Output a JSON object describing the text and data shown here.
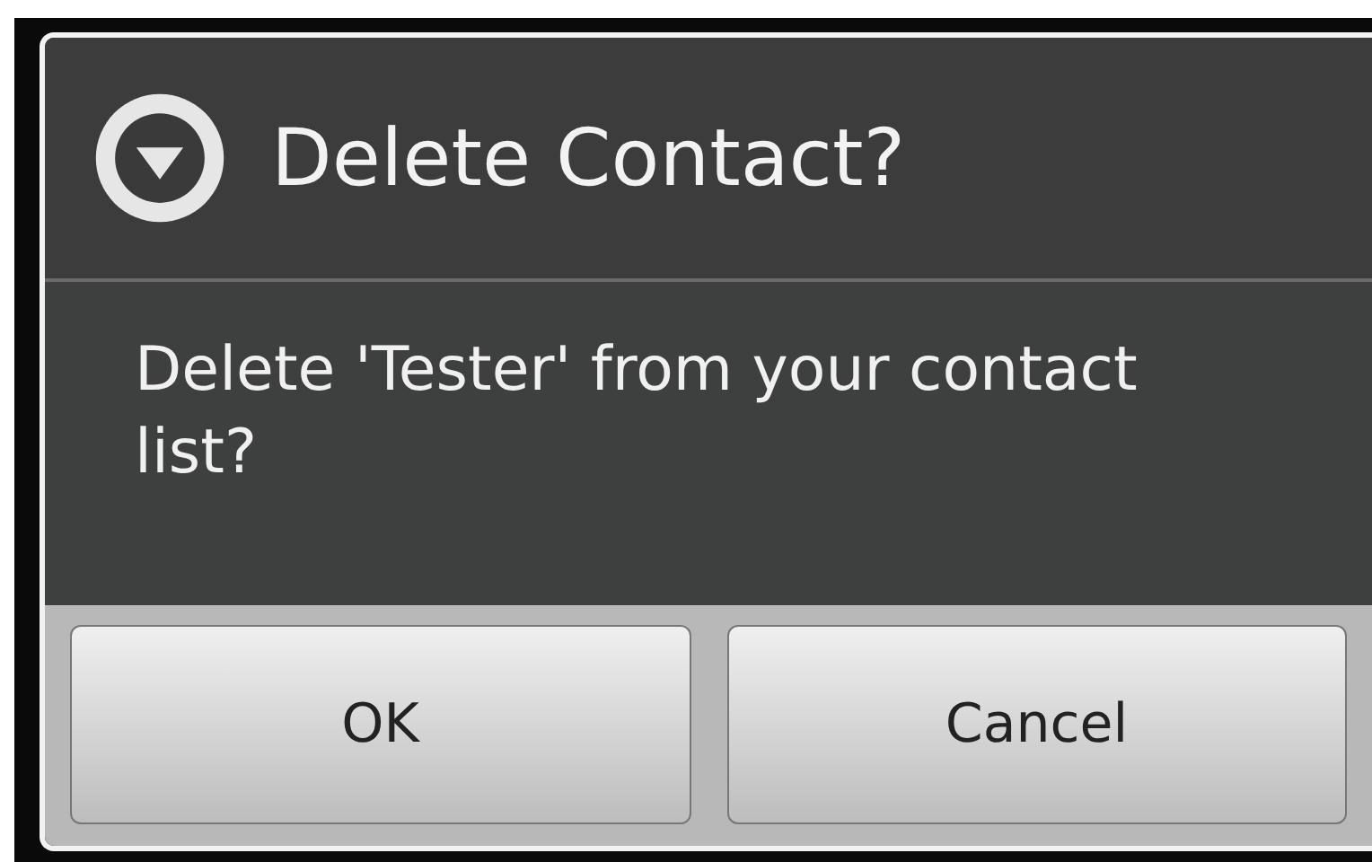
{
  "dialog": {
    "title": "Delete Contact?",
    "message": "Delete 'Tester' from your contact list?",
    "buttons": [
      {
        "label": "OK"
      },
      {
        "label": "Cancel"
      }
    ]
  }
}
